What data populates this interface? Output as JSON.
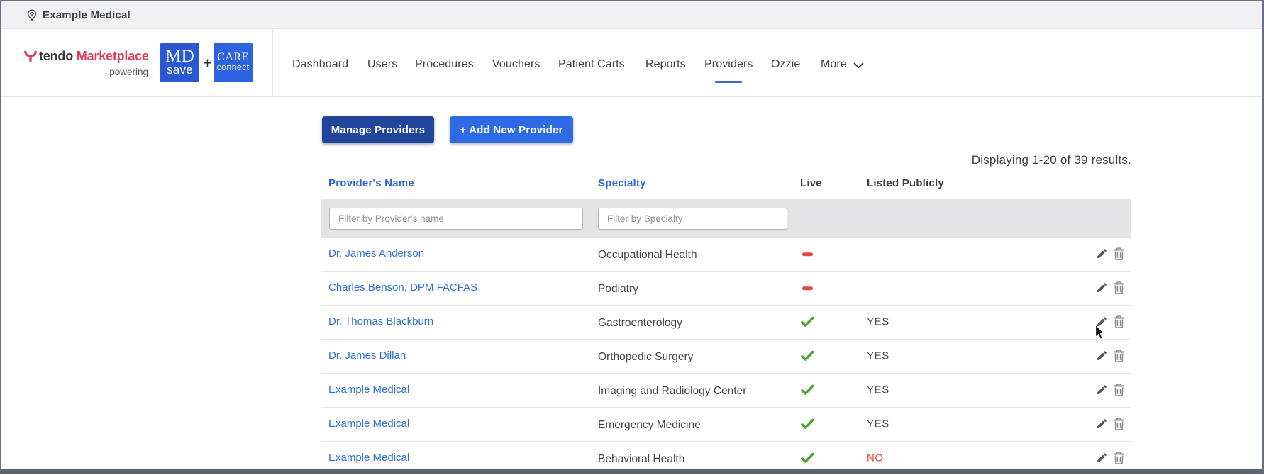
{
  "topbar": {
    "location": "Example Medical"
  },
  "brand": {
    "name_dark": "tendo",
    "name_accent": "Marketplace",
    "powering": "powering",
    "mdsave": {
      "line1": "MD",
      "line2": "save"
    },
    "plus": "+",
    "careconnect": {
      "line1": "CARE",
      "line2": "connect"
    }
  },
  "nav": {
    "items": [
      {
        "label": "Dashboard",
        "active": false
      },
      {
        "label": "Users",
        "active": false
      },
      {
        "label": "Procedures",
        "active": false
      },
      {
        "label": "Vouchers",
        "active": false
      },
      {
        "label": "Patient Carts",
        "active": false
      },
      {
        "label": "Reports",
        "active": false
      },
      {
        "label": "Providers",
        "active": true
      },
      {
        "label": "Ozzie",
        "active": false
      },
      {
        "label": "More",
        "active": false,
        "has_chevron": true
      }
    ]
  },
  "toolbar": {
    "manage_label": "Manage Providers",
    "add_label": "+ Add New Provider"
  },
  "results_summary": "Displaying 1-20 of 39 results.",
  "table": {
    "columns": {
      "name": "Provider's Name",
      "specialty": "Specialty",
      "live": "Live",
      "listed": "Listed Publicly"
    },
    "filters": {
      "name_placeholder": "Filter by Provider's name",
      "specialty_placeholder": "Filter by Specialty"
    },
    "rows": [
      {
        "name": "Dr. James Anderson",
        "specialty": "Occupational Health",
        "live": "no",
        "listed": ""
      },
      {
        "name": "Charles Benson, DPM FACFAS",
        "specialty": "Podiatry",
        "live": "no",
        "listed": ""
      },
      {
        "name": "Dr. Thomas Blackburn",
        "specialty": "Gastroenterology",
        "live": "yes",
        "listed": "YES"
      },
      {
        "name": "Dr. James Dillan",
        "specialty": "Orthopedic Surgery",
        "live": "yes",
        "listed": "YES"
      },
      {
        "name": "Example Medical",
        "specialty": "Imaging and Radiology Center",
        "live": "yes",
        "listed": "YES"
      },
      {
        "name": "Example Medical",
        "specialty": "Emergency Medicine",
        "live": "yes",
        "listed": "YES"
      },
      {
        "name": "Example Medical",
        "specialty": "Behavioral Health",
        "live": "yes",
        "listed": "NO"
      }
    ]
  },
  "colors": {
    "accent_blue": "#2d6ae4",
    "navy_button": "#20459a",
    "link_blue": "#2e6fd2",
    "live_green": "#4aa330",
    "not_live_red": "#e5473b",
    "no_red": "#e8432b",
    "brand_pink": "#d8405f"
  }
}
